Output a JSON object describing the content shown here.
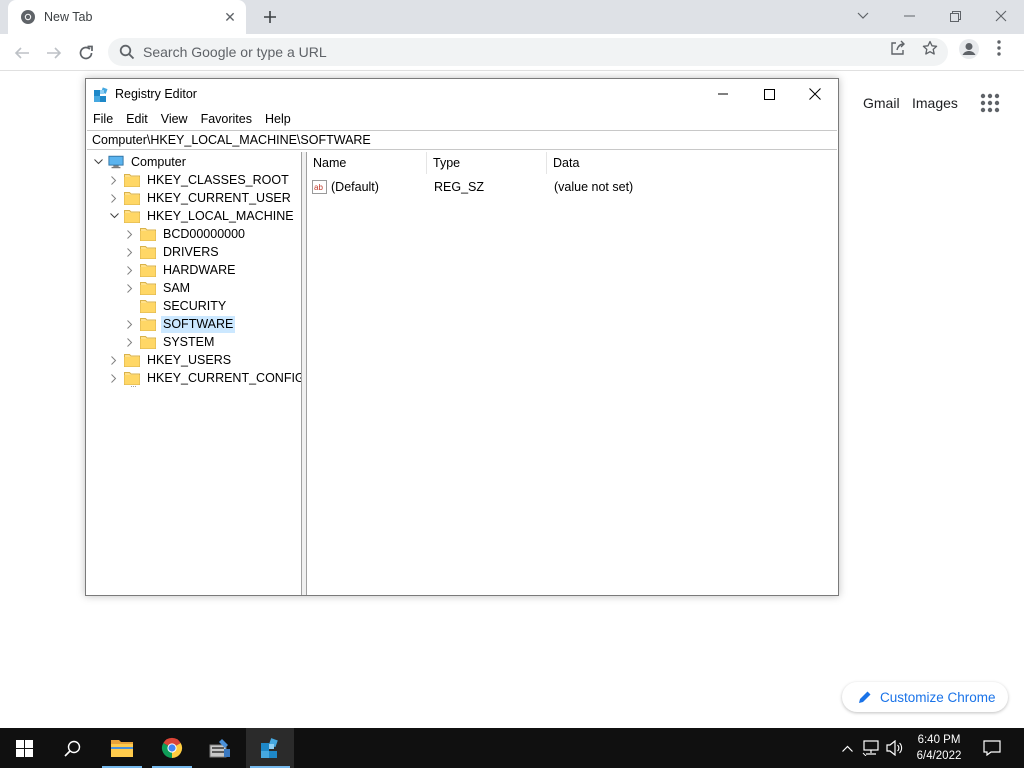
{
  "browser": {
    "tab_title": "New Tab",
    "tab_close": "✕",
    "new_tab": "+",
    "omnibox_placeholder": "Search Google or type a URL",
    "ntp_links": [
      "Gmail",
      "Images"
    ],
    "customize_label": "Customize Chrome"
  },
  "regedit": {
    "title": "Registry Editor",
    "menu": [
      "File",
      "Edit",
      "View",
      "Favorites",
      "Help"
    ],
    "address": "Computer\\HKEY_LOCAL_MACHINE\\SOFTWARE",
    "tree": {
      "root": "Computer",
      "hives": [
        "HKEY_CLASSES_ROOT",
        "HKEY_CURRENT_USER",
        "HKEY_LOCAL_MACHINE"
      ],
      "hklm_children": [
        "BCD00000000",
        "DRIVERS",
        "HARDWARE",
        "SAM",
        "SECURITY",
        "SOFTWARE",
        "SYSTEM"
      ],
      "hives_after": [
        "HKEY_USERS",
        "HKEY_CURRENT_CONFIG"
      ],
      "selected": "SOFTWARE"
    },
    "columns": [
      "Name",
      "Type",
      "Data"
    ],
    "values": [
      {
        "name": "(Default)",
        "type": "REG_SZ",
        "data": "(value not set)"
      }
    ]
  },
  "taskbar": {
    "time": "6:40 PM",
    "date": "6/4/2022"
  },
  "colors": {
    "selection": "#cce8ff",
    "accent": "#1a73e8",
    "taskbar": "#101010"
  }
}
